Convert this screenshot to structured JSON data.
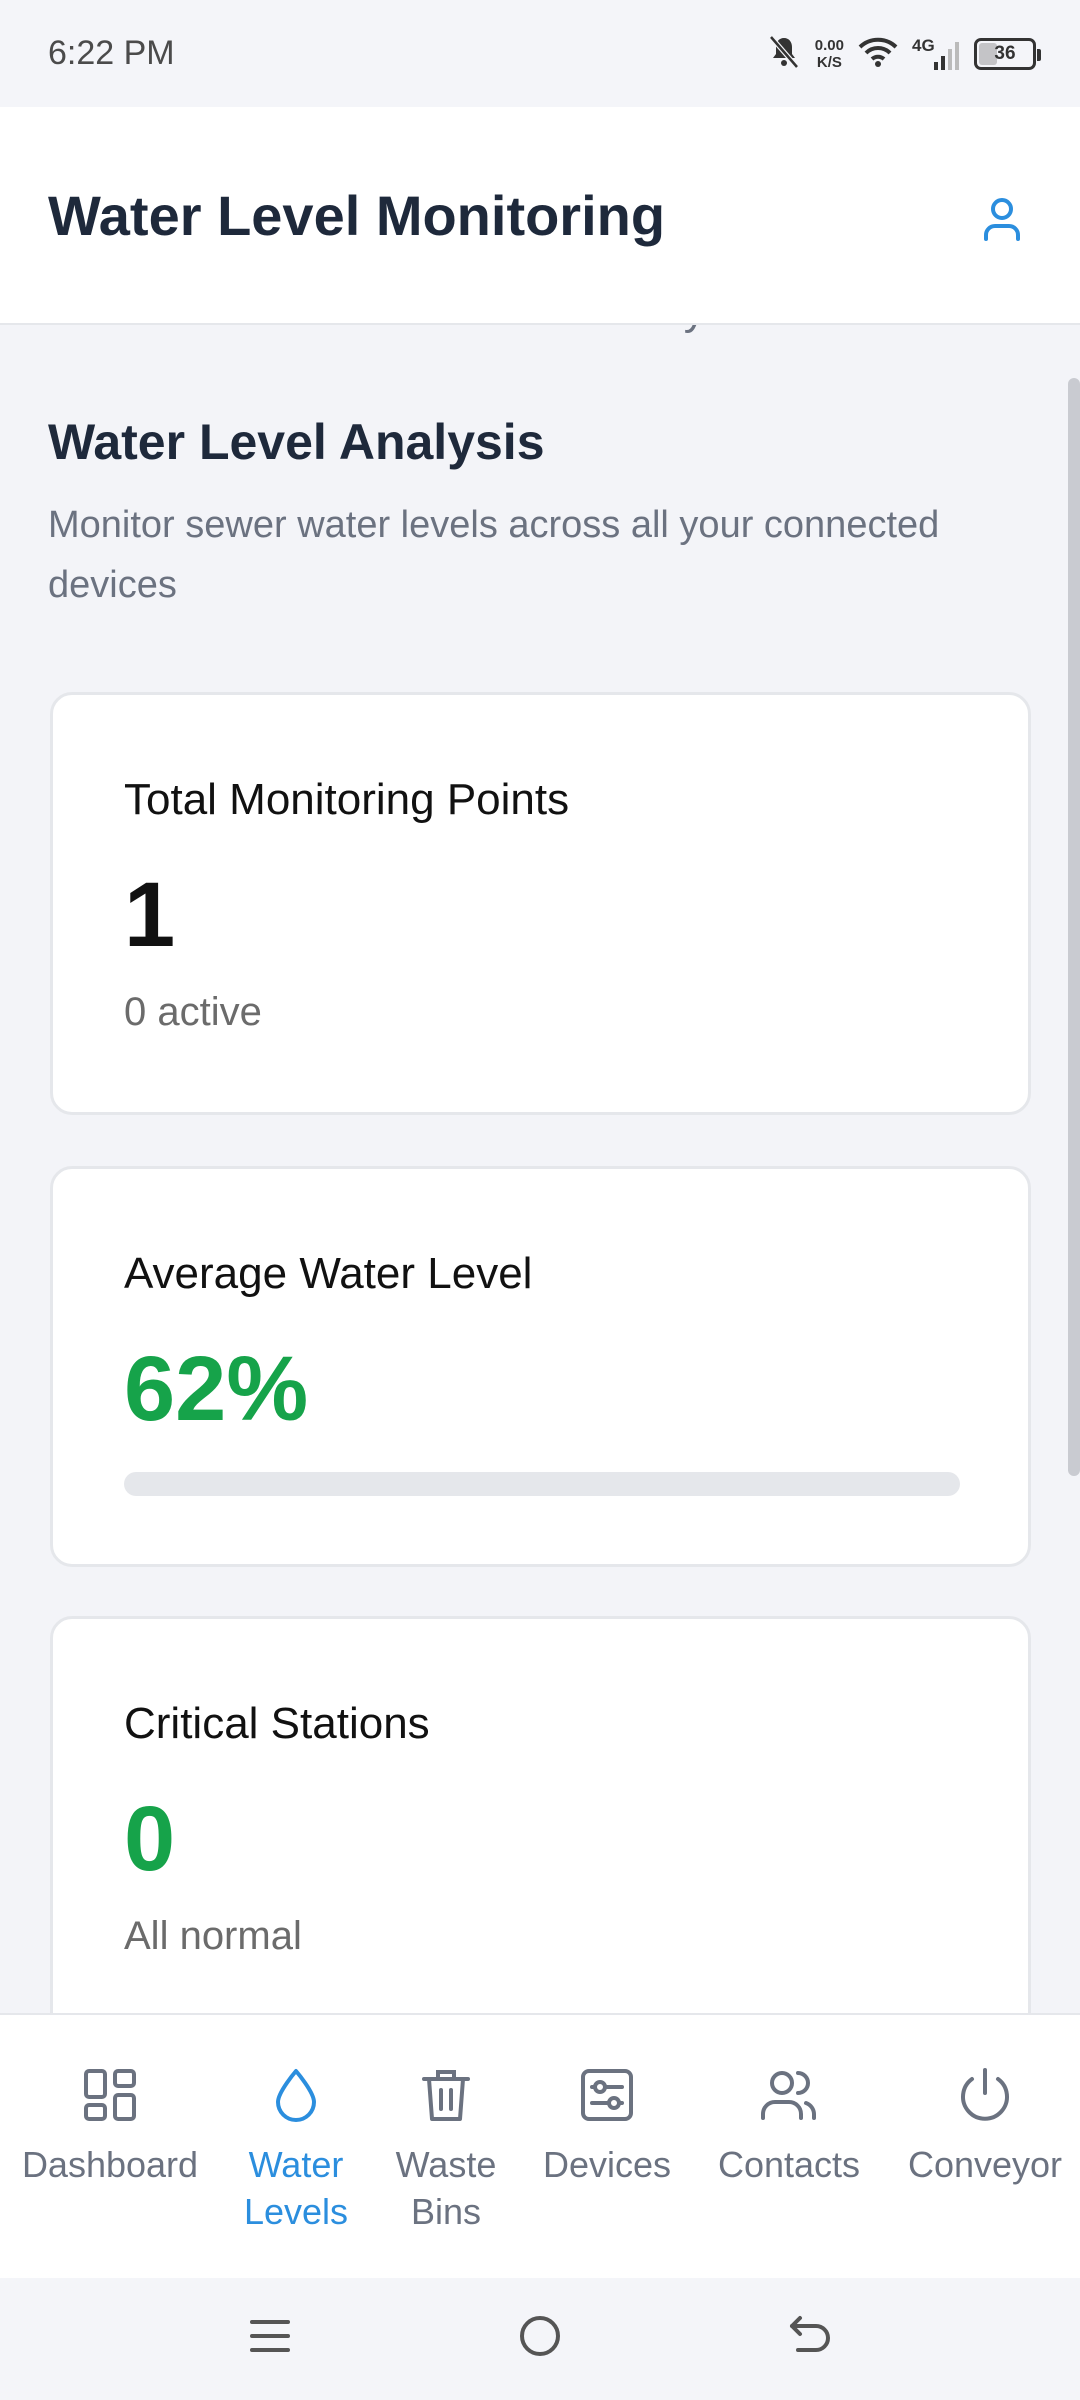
{
  "status_bar": {
    "time": "6:22 PM",
    "net_speed_value": "0.00",
    "net_speed_unit": "K/S",
    "network_type": "4G",
    "battery": "36"
  },
  "header": {
    "title": "Water Level Monitoring",
    "subtitle": "Real-time sewer water level analytics"
  },
  "section": {
    "title": "Water Level Analysis",
    "description": "Monitor sewer water levels across all your connected devices"
  },
  "cards": {
    "total": {
      "title": "Total Monitoring Points",
      "value": "1",
      "sub": "0 active"
    },
    "average": {
      "title": "Average Water Level",
      "value": "62%",
      "progress_fraction": 0.0
    },
    "critical": {
      "title": "Critical Stations",
      "value": "0",
      "sub": "All normal"
    }
  },
  "bottom_nav": {
    "items": [
      {
        "label": "Dashboard",
        "icon": "dashboard-grid-icon",
        "active": false
      },
      {
        "label": "Water Levels",
        "icon": "water-drop-icon",
        "active": true
      },
      {
        "label": "Waste Bins",
        "icon": "trash-bin-icon",
        "active": false
      },
      {
        "label": "Devices",
        "icon": "device-icon",
        "active": false
      },
      {
        "label": "Contacts",
        "icon": "contacts-icon",
        "active": false
      },
      {
        "label": "Conveyor",
        "icon": "power-icon",
        "active": false
      }
    ]
  },
  "colors": {
    "accent_blue": "#2b8ede",
    "value_green": "#16a34a",
    "text_dark": "#1e293b",
    "text_muted": "#6b7280"
  }
}
